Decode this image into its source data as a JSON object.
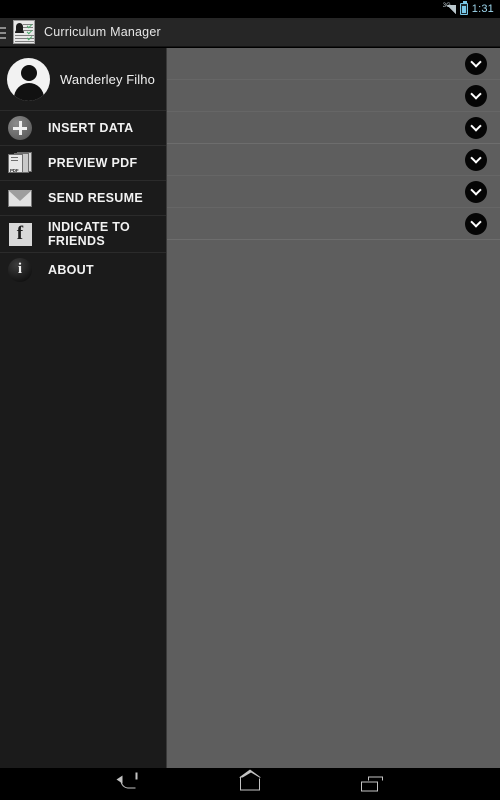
{
  "status_bar": {
    "network_label": "3G",
    "signal_icon": "signal-bars-icon",
    "battery_icon": "battery-icon",
    "time": "1:31"
  },
  "action_bar": {
    "drawer_indicator_icon": "hamburger-menu-icon",
    "app_icon": "curriculum-document-icon",
    "title": "Curriculum Manager"
  },
  "drawer": {
    "profile": {
      "avatar_icon": "person-avatar-icon",
      "name": "Wanderley Filho"
    },
    "items": [
      {
        "label": "INSERT DATA",
        "icon": "plus-circle-icon"
      },
      {
        "label": "PREVIEW PDF",
        "icon": "pdf-document-icon"
      },
      {
        "label": "SEND RESUME",
        "icon": "envelope-icon"
      },
      {
        "label": "INDICATE TO FRIENDS",
        "icon": "facebook-icon"
      },
      {
        "label": "ABOUT",
        "icon": "info-circle-icon"
      }
    ]
  },
  "content": {
    "expander_icon": "chevron-down-icon",
    "rows": [
      {
        "expandable": true
      },
      {
        "expandable": true
      },
      {
        "expandable": true
      },
      {
        "expandable": true
      },
      {
        "expandable": true
      },
      {
        "expandable": true
      }
    ]
  },
  "nav_bar": {
    "back_icon": "back-arrow-icon",
    "home_icon": "home-icon",
    "recents_icon": "recent-apps-icon"
  },
  "colors": {
    "drawer_background": "#1b1b1b",
    "content_background": "#5e5e5e",
    "action_bar_background": "#262626",
    "status_bar_background": "#000000",
    "accent_time": "#9fd8ef",
    "text_primary": "#f2f2f2"
  }
}
